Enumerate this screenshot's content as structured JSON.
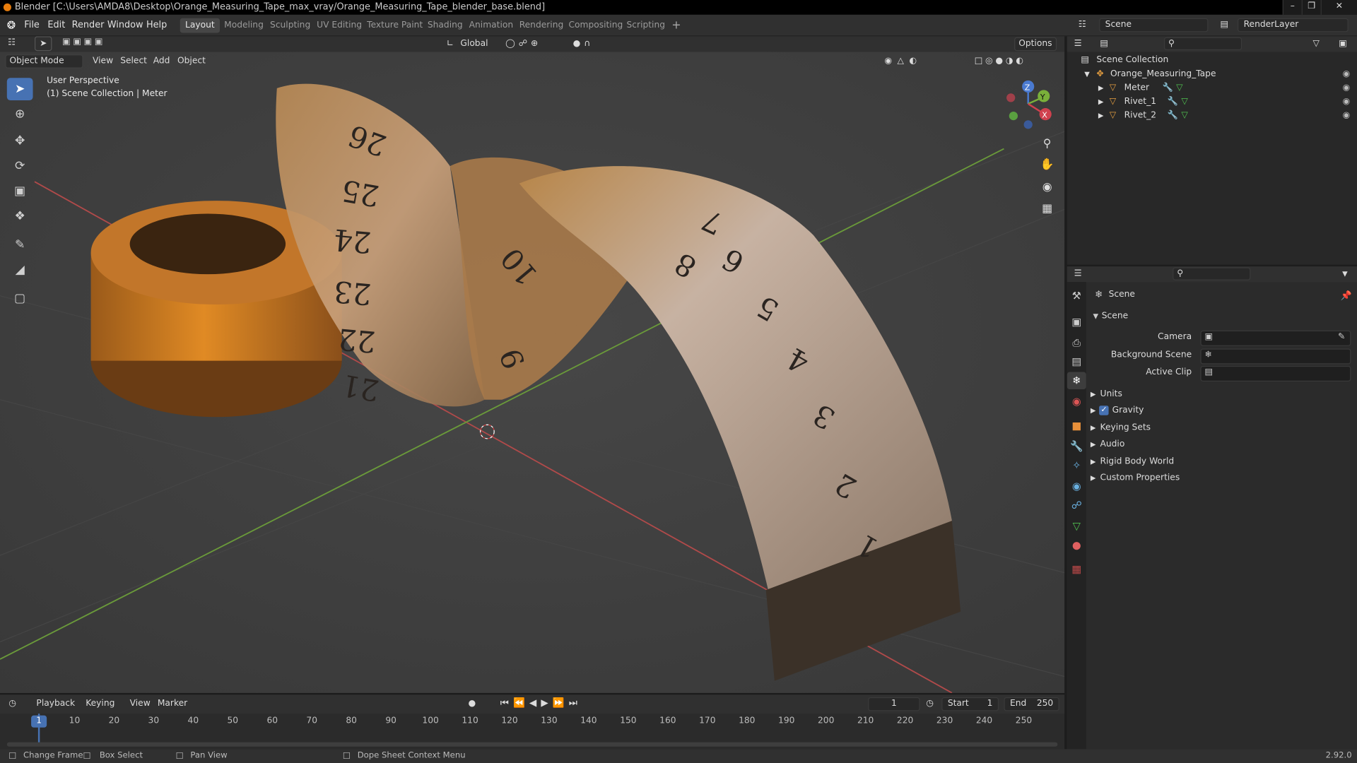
{
  "window": {
    "title": "Blender [C:\\Users\\AMDA8\\Desktop\\Orange_Measuring_Tape_max_vray/Orange_Measuring_Tape_blender_base.blend]"
  },
  "menu": [
    "File",
    "Edit",
    "Render",
    "Window",
    "Help"
  ],
  "workspaces": [
    "Layout",
    "Modeling",
    "Sculpting",
    "UV Editing",
    "Texture Paint",
    "Shading",
    "Animation",
    "Rendering",
    "Compositing",
    "Scripting"
  ],
  "active_workspace": "Layout",
  "scene_selector": "Scene",
  "view_layer": "RenderLayer",
  "viewport": {
    "mode": "Object Mode",
    "menus": [
      "View",
      "Select",
      "Add",
      "Object"
    ],
    "orientation": "Global",
    "options_label": "Options",
    "overlay_line1": "User Perspective",
    "overlay_line2": "(1) Scene Collection | Meter",
    "gizmo": {
      "z": "Z",
      "y": "Y",
      "x": "X"
    },
    "tape_numbers": [
      "26",
      "25",
      "24",
      "23",
      "22",
      "21",
      "10",
      "9",
      "8",
      "7",
      "6",
      "5",
      "4",
      "3",
      "2",
      "1"
    ]
  },
  "outliner": {
    "root": "Scene Collection",
    "collection": "Orange_Measuring_Tape",
    "objects": [
      "Meter",
      "Rivet_1",
      "Rivet_2"
    ]
  },
  "properties": {
    "header": "Scene",
    "panel_title": "Scene",
    "fields": [
      {
        "label": "Camera",
        "value": ""
      },
      {
        "label": "Background Scene",
        "value": ""
      },
      {
        "label": "Active Clip",
        "value": ""
      }
    ],
    "subpanels": [
      "Units",
      "Gravity",
      "Keying Sets",
      "Audio",
      "Rigid Body World",
      "Custom Properties"
    ],
    "gravity_checked": true
  },
  "timeline": {
    "menus": [
      "Playback",
      "Keying",
      "View",
      "Marker"
    ],
    "current_frame": "1",
    "start_label": "Start",
    "start": "1",
    "end_label": "End",
    "end": "250",
    "ticks": [
      "1",
      "10",
      "20",
      "30",
      "40",
      "50",
      "60",
      "70",
      "80",
      "90",
      "100",
      "110",
      "120",
      "130",
      "140",
      "150",
      "160",
      "170",
      "180",
      "190",
      "200",
      "210",
      "220",
      "230",
      "240",
      "250"
    ]
  },
  "statusbar": {
    "items": [
      "Change Frame",
      "Box Select",
      "Pan View",
      "Dope Sheet Context Menu"
    ],
    "version": "2.92.0"
  },
  "colors": {
    "accent": "#4772b3",
    "tape_orange": "#c07a2a",
    "x_axis": "#d0414e",
    "y_axis": "#7ab03a"
  }
}
